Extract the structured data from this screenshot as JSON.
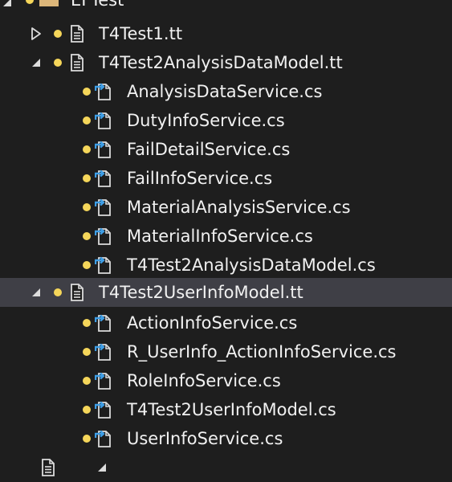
{
  "tree": {
    "colors": {
      "dot": "#f5d65a",
      "icon": "#dcdcdc",
      "link": "#3e9ee6",
      "selected_bg": "#3f3f46",
      "text": "#f1f1f1"
    },
    "project": {
      "label": "EFTest",
      "icon": "folder-icon"
    },
    "t4test1": {
      "label": "T4Test1.tt",
      "expanded": false,
      "icon": "text-file-icon"
    },
    "analysis_model": {
      "label": "T4Test2AnalysisDataModel.tt",
      "expanded": true,
      "icon": "text-file-icon",
      "children": [
        {
          "label": "AnalysisDataService.cs"
        },
        {
          "label": "DutyInfoService.cs"
        },
        {
          "label": "FailDetailService.cs"
        },
        {
          "label": "FailInfoService.cs"
        },
        {
          "label": "MaterialAnalysisService.cs"
        },
        {
          "label": "MaterialInfoService.cs"
        },
        {
          "label": "T4Test2AnalysisDataModel.cs"
        }
      ]
    },
    "userinfo_model": {
      "label": "T4Test2UserInfoModel.tt",
      "expanded": true,
      "selected": true,
      "icon": "text-file-icon",
      "children": [
        {
          "label": "ActionInfoService.cs"
        },
        {
          "label": "R_UserInfo_ActionInfoService.cs"
        },
        {
          "label": "RoleInfoService.cs"
        },
        {
          "label": "T4Test2UserInfoModel.cs"
        },
        {
          "label": "UserInfoService.cs"
        }
      ]
    }
  }
}
